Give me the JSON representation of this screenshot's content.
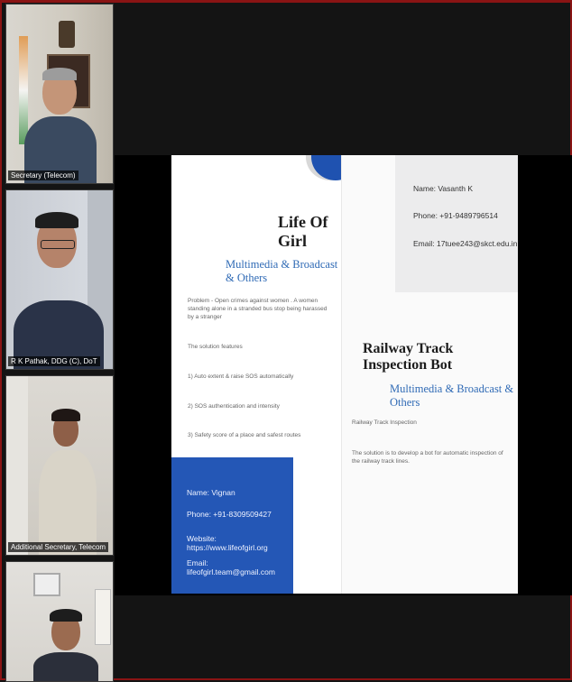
{
  "participants": [
    {
      "name": "Secretary (Telecom)"
    },
    {
      "name": "R K Pathak, DDG (C), DoT"
    },
    {
      "name": "Additional Secretary, Telecom"
    },
    {
      "name": ""
    }
  ],
  "slide": {
    "left_card": {
      "title": "Life Of Girl",
      "category": "Multimedia & Broadcast & Others",
      "problem": "Problem - Open crimes against women . A women standing alone in a stranded bus stop being harassed by a stranger",
      "features_heading": "The solution features",
      "feature_1": "1) Auto extent & raise SOS automatically",
      "feature_2": "2) SOS authentication and intensity",
      "feature_3": "3) Safety score of a place and safest routes",
      "contact": {
        "name": "Name: Vignan",
        "phone": "Phone: +91-8309509427",
        "website": "Website: https://www.lifeofgirl.org",
        "email": "Email: lifeofgirl.team@gmail.com"
      }
    },
    "right_card": {
      "contact": {
        "name": "Name: Vasanth K",
        "phone": "Phone: +91-9489796514",
        "email": "Email: 17tuee243@skct.edu.in"
      },
      "title": "Railway Track Inspection Bot",
      "category": "Multimedia & Broadcast & Others",
      "problem": "Railway Track Inspection",
      "solution": "The solution is to develop a bot for automatic inspection of the railway track lines."
    }
  },
  "colors": {
    "accent_blue": "#2457b6",
    "title_blue": "#2f6ab5",
    "background": "#141414"
  }
}
